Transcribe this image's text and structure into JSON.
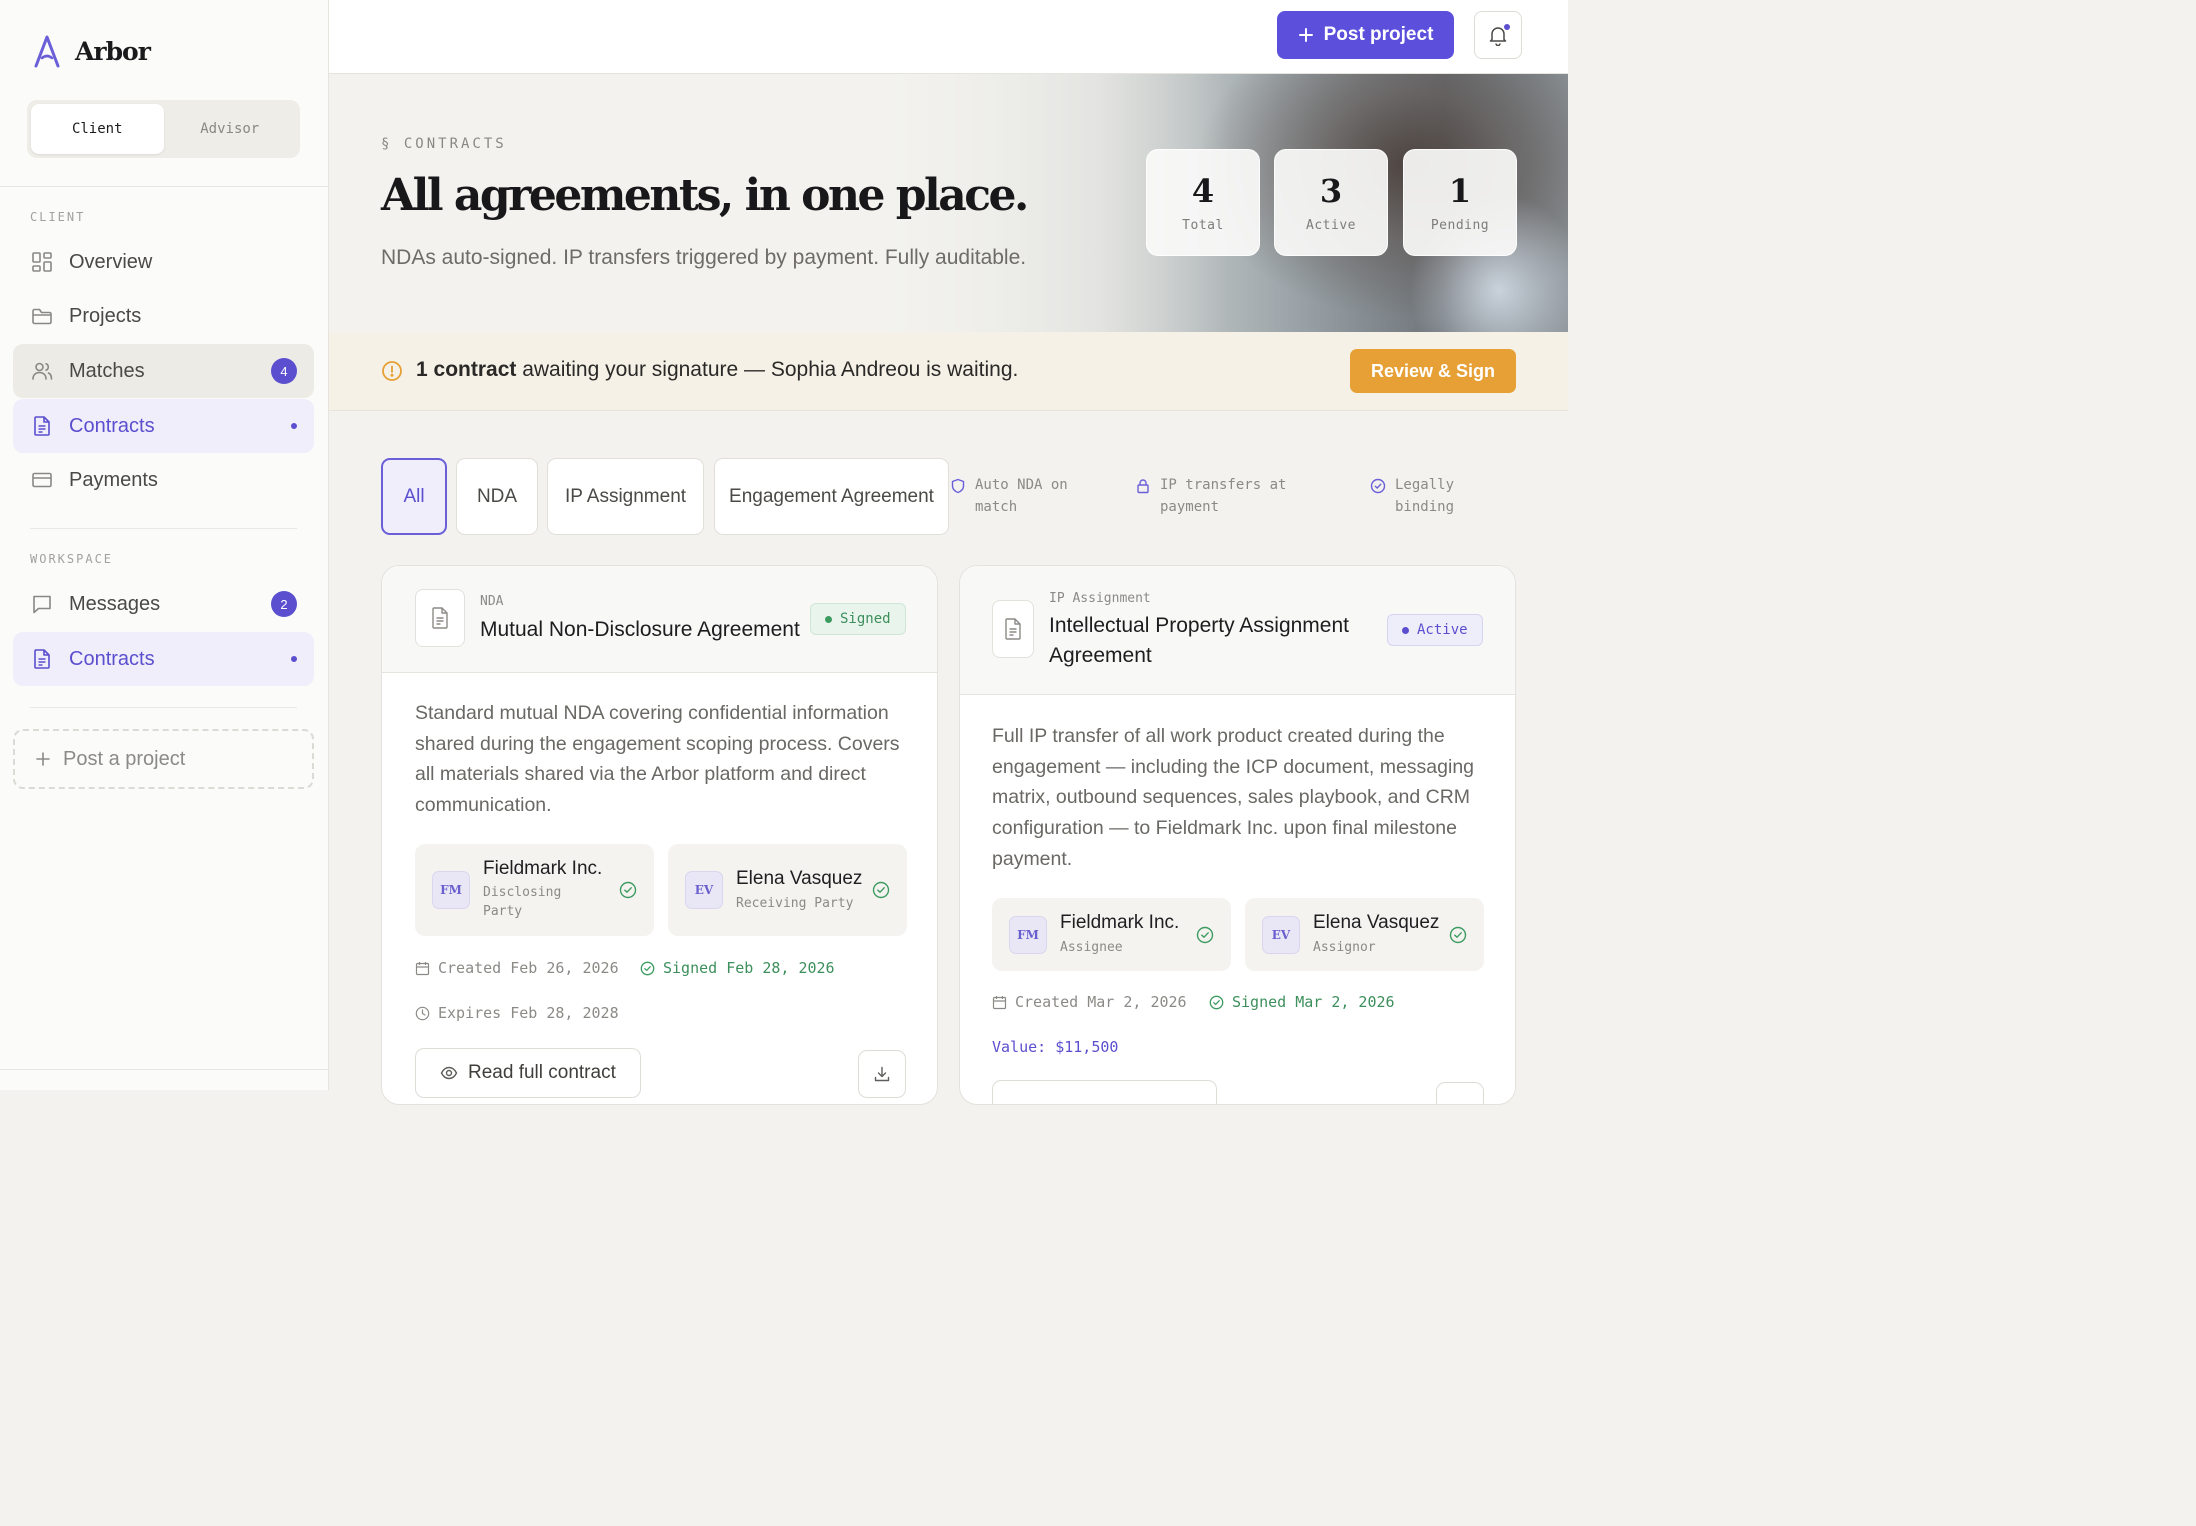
{
  "app": {
    "name": "Arbor"
  },
  "role_switch": {
    "client": "Client",
    "advisor": "Advisor"
  },
  "sidebar": {
    "client_section": "CLIENT",
    "workspace_section": "WORKSPACE",
    "items": [
      {
        "label": "Overview"
      },
      {
        "label": "Projects"
      },
      {
        "label": "Matches",
        "badge": "4"
      },
      {
        "label": "Contracts"
      },
      {
        "label": "Payments"
      }
    ],
    "workspace_items": [
      {
        "label": "Messages",
        "badge": "2"
      },
      {
        "label": "Contracts"
      }
    ],
    "post_project": "Post a project"
  },
  "topbar": {
    "post_project": "Post project"
  },
  "hero": {
    "eyebrow": "§ CONTRACTS",
    "title": "All agreements, in one place.",
    "subtitle": "NDAs auto-signed. IP transfers triggered by payment. Fully auditable.",
    "stats": [
      {
        "value": "4",
        "label": "Total"
      },
      {
        "value": "3",
        "label": "Active"
      },
      {
        "value": "1",
        "label": "Pending"
      }
    ]
  },
  "alert": {
    "bold": "1 contract",
    "text": " awaiting your signature — Sophia Andreou is waiting.",
    "button": "Review & Sign"
  },
  "filters": [
    "All",
    "NDA",
    "IP Assignment",
    "Engagement Agreement"
  ],
  "features": [
    "Auto NDA on match",
    "IP transfers at payment",
    "Legally binding"
  ],
  "contracts": [
    {
      "type": "NDA",
      "title": "Mutual Non-Disclosure Agreement",
      "status": "Signed",
      "description": "Standard mutual NDA covering confidential information shared during the engagement scoping process. Covers all materials shared via the Arbor platform and direct communication.",
      "parties": [
        {
          "initials": "FM",
          "name": "Fieldmark Inc.",
          "role": "Disclosing Party"
        },
        {
          "initials": "EV",
          "name": "Elena Vasquez",
          "role": "Receiving Party"
        }
      ],
      "created": "Created Feb 26, 2026",
      "signed": "Signed Feb 28, 2026",
      "expires": "Expires Feb 28, 2028",
      "read_button": "Read full contract"
    },
    {
      "type": "IP Assignment",
      "title": "Intellectual Property Assignment Agreement",
      "status": "Active",
      "description": "Full IP transfer of all work product created during the engagement — including the ICP document, messaging matrix, outbound sequences, sales playbook, and CRM configuration — to Fieldmark Inc. upon final milestone payment.",
      "parties": [
        {
          "initials": "FM",
          "name": "Fieldmark Inc.",
          "role": "Assignee"
        },
        {
          "initials": "EV",
          "name": "Elena Vasquez",
          "role": "Assignor"
        }
      ],
      "created": "Created Mar 2, 2026",
      "signed": "Signed Mar 2, 2026",
      "value": "Value: $11,500"
    }
  ]
}
